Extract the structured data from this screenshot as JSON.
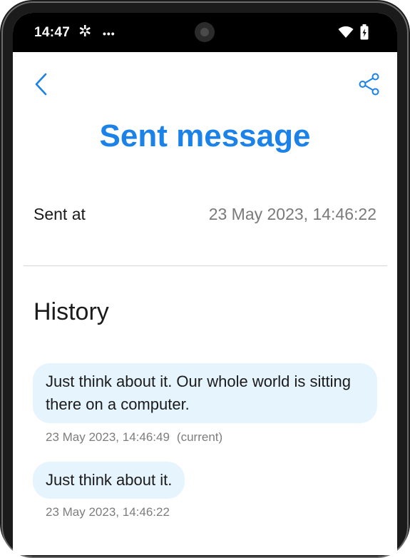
{
  "status_bar": {
    "time": "14:47",
    "notification_glyph": "✲",
    "more_glyph": "•••"
  },
  "header": {
    "back_icon": "chevron-left",
    "share_icon": "share",
    "title": "Sent message"
  },
  "details": {
    "sent_label": "Sent at",
    "sent_value": "23 May 2023, 14:46:22"
  },
  "history": {
    "title": "History",
    "entries": [
      {
        "text": "Just think about it. Our whole world is sitting there on a computer.",
        "timestamp": "23 May 2023, 14:46:49",
        "note": "(current)"
      },
      {
        "text": "Just think about it.",
        "timestamp": "23 May 2023, 14:46:22"
      }
    ]
  },
  "colors": {
    "accent": "#1a82e9",
    "bubble": "#e6f4fe",
    "muted_text": "#7a7a7a"
  }
}
